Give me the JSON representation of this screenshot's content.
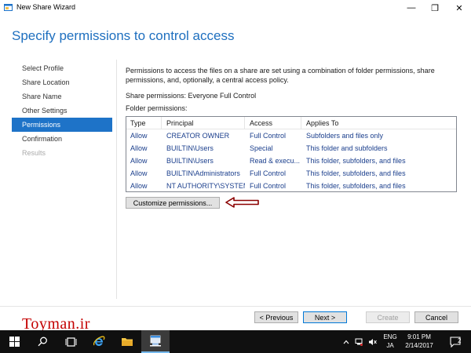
{
  "window": {
    "title": "New Share Wizard",
    "minimize_glyph": "—",
    "restore_glyph": "❐",
    "close_glyph": "✕"
  },
  "page": {
    "heading": "Specify permissions to control access"
  },
  "steps": [
    {
      "label": "Select Profile",
      "state": "normal"
    },
    {
      "label": "Share Location",
      "state": "normal"
    },
    {
      "label": "Share Name",
      "state": "normal"
    },
    {
      "label": "Other Settings",
      "state": "normal"
    },
    {
      "label": "Permissions",
      "state": "active"
    },
    {
      "label": "Confirmation",
      "state": "normal"
    },
    {
      "label": "Results",
      "state": "disabled"
    }
  ],
  "content": {
    "description": "Permissions to access the files on a share are set using a combination of folder permissions, share permissions, and, optionally, a central access policy.",
    "share_permissions": "Share permissions: Everyone Full Control",
    "folder_permissions_label": "Folder permissions:",
    "table": {
      "headers": [
        "Type",
        "Principal",
        "Access",
        "Applies To"
      ],
      "rows": [
        [
          "Allow",
          "CREATOR OWNER",
          "Full Control",
          "Subfolders and files only"
        ],
        [
          "Allow",
          "BUILTIN\\Users",
          "Special",
          "This folder and subfolders"
        ],
        [
          "Allow",
          "BUILTIN\\Users",
          "Read & execu...",
          "This folder, subfolders, and files"
        ],
        [
          "Allow",
          "BUILTIN\\Administrators",
          "Full Control",
          "This folder, subfolders, and files"
        ],
        [
          "Allow",
          "NT AUTHORITY\\SYSTEM",
          "Full Control",
          "This folder, subfolders, and files"
        ]
      ]
    },
    "customize_button": "Customize permissions..."
  },
  "footer": {
    "previous": "< Previous",
    "next": "Next >",
    "create": "Create",
    "cancel": "Cancel"
  },
  "watermark": "Toyman.ir",
  "taskbar": {
    "language_top": "ENG",
    "language_bottom": "JA",
    "time": "9:01 PM",
    "date": "2/14/2017",
    "notification_count": "2"
  },
  "colors": {
    "accent": "#1e73c8",
    "heading": "#1e6fbf",
    "table_text": "#1a3e8c",
    "arrow": "#8b0000",
    "watermark": "#c40000"
  }
}
